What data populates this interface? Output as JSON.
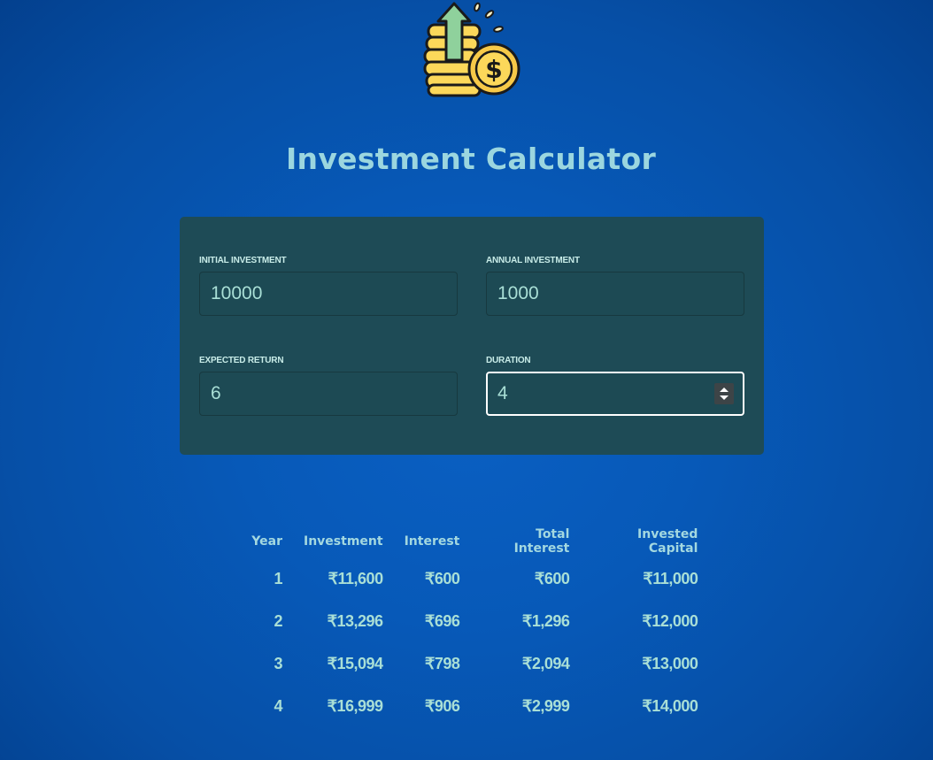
{
  "header": {
    "logo_icon": "coins-dollar-arrow-up-icon",
    "title": "Investment Calculator"
  },
  "form": {
    "initial_investment": {
      "label": "Initial Investment",
      "value": "10000"
    },
    "annual_investment": {
      "label": "Annual Investment",
      "value": "1000"
    },
    "expected_return": {
      "label": "Expected Return",
      "value": "6"
    },
    "duration": {
      "label": "Duration",
      "value": "4"
    }
  },
  "results": {
    "headers": {
      "year": "Year",
      "investment": "Investment",
      "interest": "Interest",
      "total_interest": "Total Interest",
      "invested_capital": "Invested Capital"
    },
    "rows": [
      {
        "year": "1",
        "investment": "₹11,600",
        "interest": "₹600",
        "total_interest": "₹600",
        "invested_capital": "₹11,000"
      },
      {
        "year": "2",
        "investment": "₹13,296",
        "interest": "₹696",
        "total_interest": "₹1,296",
        "invested_capital": "₹12,000"
      },
      {
        "year": "3",
        "investment": "₹15,094",
        "interest": "₹798",
        "total_interest": "₹2,094",
        "invested_capital": "₹13,000"
      },
      {
        "year": "4",
        "investment": "₹16,999",
        "interest": "₹906",
        "total_interest": "₹2,999",
        "invested_capital": "₹14,000"
      }
    ]
  },
  "colors": {
    "background": "#0759b8",
    "panel": "#1e4b56",
    "accent_text": "#a9dfd6",
    "title": "#9bd6df"
  }
}
